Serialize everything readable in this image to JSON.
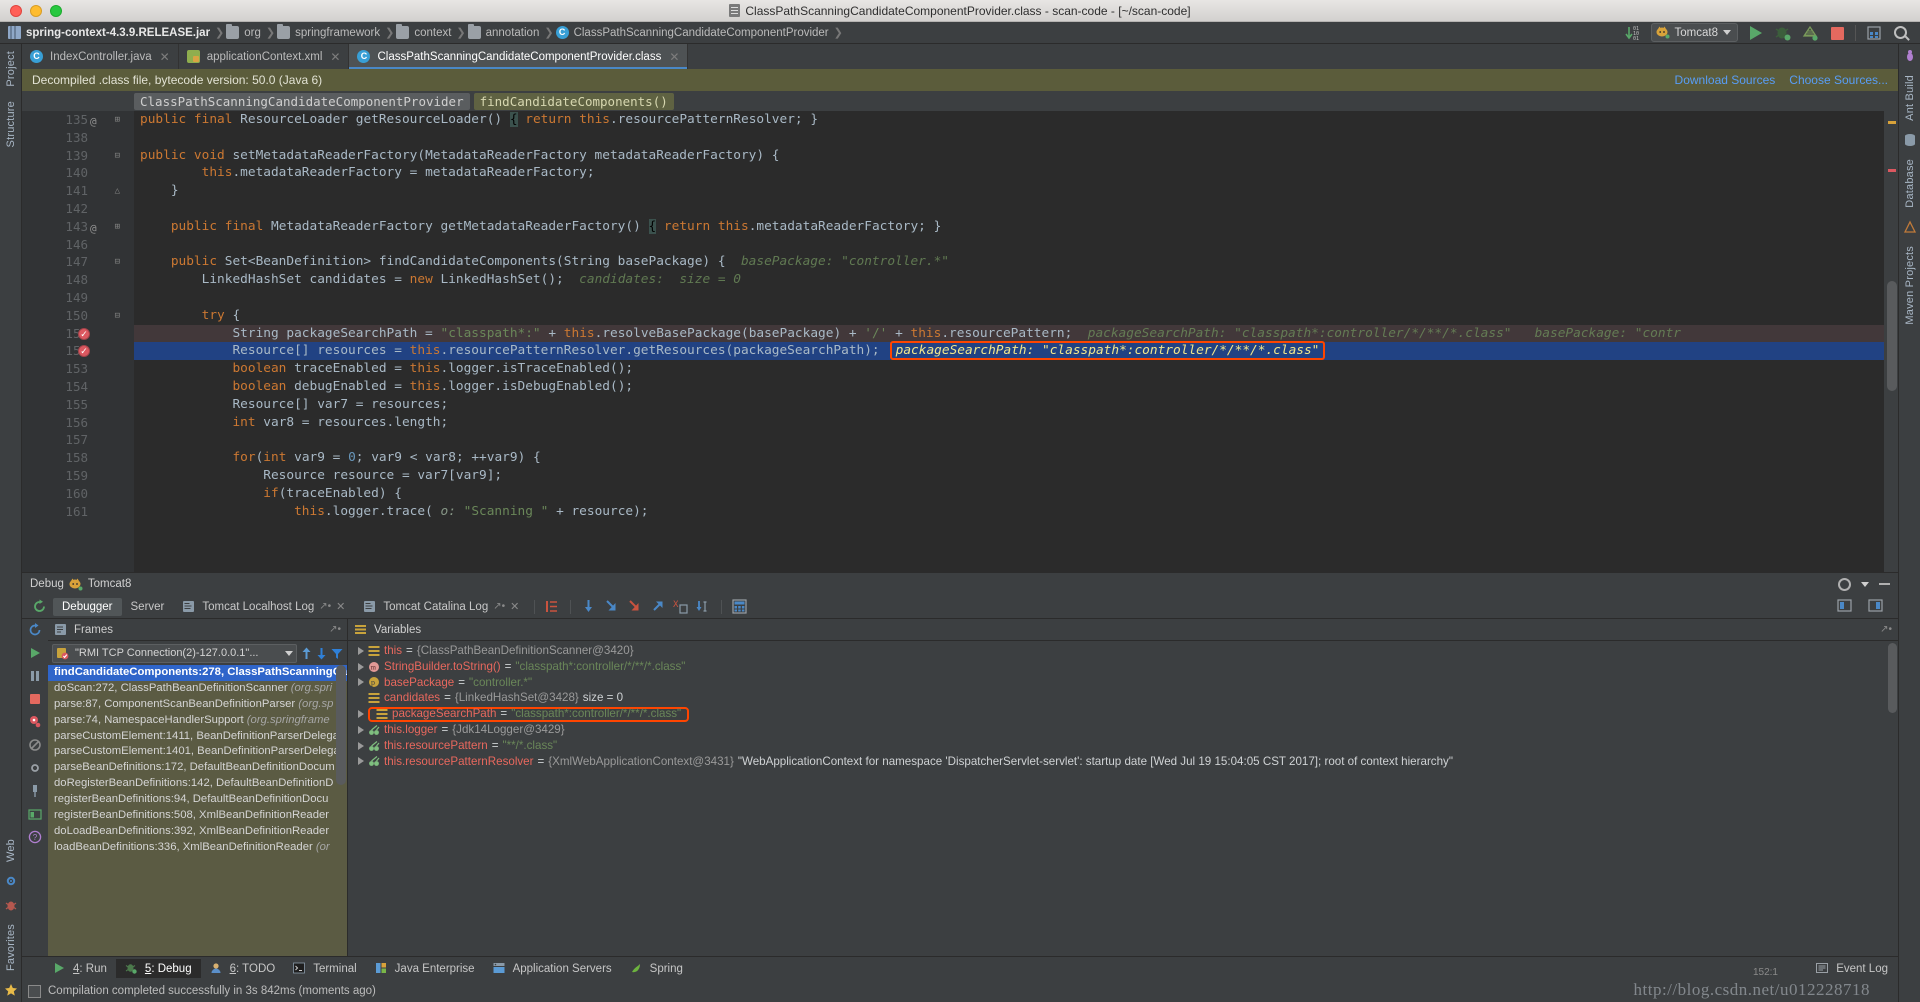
{
  "window": {
    "title": "ClassPathScanningCandidateComponentProvider.class - scan-code - [~/scan-code]",
    "title_icon": "document-icon"
  },
  "breadcrumb": {
    "items": [
      {
        "label": "spring-context-4.3.9.RELEASE.jar",
        "icon": "jar-icon",
        "bold": true
      },
      {
        "label": "org",
        "icon": "folder-icon",
        "bold": false
      },
      {
        "label": "springframework",
        "icon": "folder-icon",
        "bold": false
      },
      {
        "label": "context",
        "icon": "folder-icon",
        "bold": false
      },
      {
        "label": "annotation",
        "icon": "folder-icon",
        "bold": false
      },
      {
        "label": "ClassPathScanningCandidateComponentProvider",
        "icon": "class-icon",
        "bold": false
      }
    ],
    "separator": "›"
  },
  "toolbar": {
    "run_config": "Tomcat8",
    "buttons": [
      {
        "name": "update-running-app-icon",
        "label": ""
      },
      {
        "name": "run-button",
        "label": ""
      },
      {
        "name": "debug-button",
        "label": ""
      },
      {
        "name": "coverage-button",
        "label": ""
      },
      {
        "name": "stop-button",
        "label": ""
      },
      {
        "name": "layout-button",
        "label": ""
      },
      {
        "name": "search-everywhere-button",
        "label": ""
      }
    ]
  },
  "left_strip": {
    "tabs": [
      "Project",
      "Structure",
      "Favorites"
    ],
    "bottom_tabs": [
      "Web"
    ]
  },
  "right_strip": {
    "tabs": [
      "Ant Build",
      "Database",
      "Maven Projects"
    ]
  },
  "editor_tabs": [
    {
      "label": "IndexController.java",
      "icon": "java-class-icon",
      "active": false,
      "closable": true
    },
    {
      "label": "applicationContext.xml",
      "icon": "xml-file-icon",
      "active": false,
      "closable": true
    },
    {
      "label": "ClassPathScanningCandidateComponentProvider.class",
      "icon": "decompiled-class-icon",
      "active": true,
      "closable": true
    }
  ],
  "notice": {
    "text": "Decompiled .class file, bytecode version: 50.0 (Java 6)",
    "links": [
      "Download Sources",
      "Choose Sources..."
    ]
  },
  "chips": [
    {
      "label": "ClassPathScanningCandidateComponentProvider",
      "current": false
    },
    {
      "label": "findCandidateComponents()",
      "current": true
    }
  ],
  "editor": {
    "first_visible_line": 135,
    "lines": [
      {
        "num": "135",
        "partial": true,
        "breakpoint": false,
        "at": true,
        "fold": "+",
        "highlight": "none",
        "tokens": [
          {
            "t": "kw",
            "v": "public final "
          },
          {
            "t": "txt",
            "v": "ResourceLoader getResourceLoader() "
          },
          {
            "t": "brace",
            "v": "{"
          },
          {
            "t": "kw",
            "v": " return "
          },
          {
            "t": "kw2",
            "v": "this"
          },
          {
            "t": "txt",
            "v": ".resourcePatternResolver; }"
          }
        ]
      },
      {
        "num": "138",
        "breakpoint": false,
        "fold": "",
        "highlight": "none",
        "tokens": []
      },
      {
        "num": "139",
        "breakpoint": false,
        "fold": "-",
        "highlight": "none",
        "tokens": [
          {
            "t": "kw",
            "v": "public void "
          },
          {
            "t": "txt",
            "v": "setMetadataReaderFactory(MetadataReaderFactory metadataReaderFactory) {"
          }
        ]
      },
      {
        "num": "140",
        "breakpoint": false,
        "fold": "",
        "highlight": "none",
        "tokens": [
          {
            "t": "kw2",
            "v": "        this"
          },
          {
            "t": "txt",
            "v": ".metadataReaderFactory = metadataReaderFactory;"
          }
        ]
      },
      {
        "num": "141",
        "breakpoint": false,
        "fold": "^",
        "highlight": "none",
        "tokens": [
          {
            "t": "txt",
            "v": "    }"
          }
        ]
      },
      {
        "num": "142",
        "breakpoint": false,
        "fold": "",
        "highlight": "none",
        "tokens": []
      },
      {
        "num": "143",
        "breakpoint": false,
        "at": true,
        "fold": "+",
        "highlight": "none",
        "tokens": [
          {
            "t": "kw",
            "v": "    public final "
          },
          {
            "t": "txt",
            "v": "MetadataReaderFactory getMetadataReaderFactory() "
          },
          {
            "t": "brace",
            "v": "{"
          },
          {
            "t": "kw",
            "v": " return "
          },
          {
            "t": "kw2",
            "v": "this"
          },
          {
            "t": "txt",
            "v": ".metadataReaderFactory; }"
          }
        ]
      },
      {
        "num": "146",
        "breakpoint": false,
        "fold": "",
        "highlight": "none",
        "tokens": []
      },
      {
        "num": "147",
        "breakpoint": false,
        "fold": "-",
        "highlight": "none",
        "tokens": [
          {
            "t": "kw",
            "v": "    public "
          },
          {
            "t": "txt",
            "v": "Set<BeanDefinition> findCandidateComponents(String basePackage) {"
          },
          {
            "t": "hint",
            "v": "  basePackage: \"controller.*\""
          }
        ]
      },
      {
        "num": "148",
        "breakpoint": false,
        "fold": "",
        "highlight": "none",
        "tokens": [
          {
            "t": "txt",
            "v": "        LinkedHashSet candidates = "
          },
          {
            "t": "kw",
            "v": "new "
          },
          {
            "t": "txt",
            "v": "LinkedHashSet();"
          },
          {
            "t": "hint",
            "v": "  candidates:  size = 0"
          }
        ]
      },
      {
        "num": "149",
        "breakpoint": false,
        "fold": "",
        "highlight": "none",
        "tokens": []
      },
      {
        "num": "150",
        "breakpoint": false,
        "fold": "-",
        "highlight": "none",
        "tokens": [
          {
            "t": "kw",
            "v": "        try "
          },
          {
            "t": "txt",
            "v": "{"
          }
        ]
      },
      {
        "num": "151",
        "breakpoint": true,
        "fold": "",
        "highlight": "dark",
        "tokens": [
          {
            "t": "txt",
            "v": "            String packageSearchPath = "
          },
          {
            "t": "str",
            "v": "\"classpath*:\""
          },
          {
            "t": "txt",
            "v": " + "
          },
          {
            "t": "kw2",
            "v": "this"
          },
          {
            "t": "txt",
            "v": ".resolveBasePackage(basePackage) + "
          },
          {
            "t": "str",
            "v": "'/'"
          },
          {
            "t": "txt",
            "v": " + "
          },
          {
            "t": "kw2",
            "v": "this"
          },
          {
            "t": "txt",
            "v": ".resourcePattern;"
          },
          {
            "t": "hint",
            "v": "  packageSearchPath: \"classpath*:controller/*/**/*.class\"   basePackage: \"contr"
          }
        ]
      },
      {
        "num": "152",
        "breakpoint": true,
        "fold": "",
        "highlight": "blue",
        "tokens": [
          {
            "t": "txt",
            "v": "            Resource[] resources = "
          },
          {
            "t": "kw2",
            "v": "this"
          },
          {
            "t": "txt",
            "v": ".resourcePatternResolver.getResources(packageSearchPath);"
          },
          {
            "t": "boxed",
            "v": "packageSearchPath: \"classpath*:controller/*/**/*.class\""
          }
        ]
      },
      {
        "num": "153",
        "breakpoint": false,
        "fold": "",
        "highlight": "none",
        "tokens": [
          {
            "t": "kw",
            "v": "            boolean "
          },
          {
            "t": "txt",
            "v": "traceEnabled = "
          },
          {
            "t": "kw2",
            "v": "this"
          },
          {
            "t": "txt",
            "v": ".logger.isTraceEnabled();"
          }
        ]
      },
      {
        "num": "154",
        "breakpoint": false,
        "fold": "",
        "highlight": "none",
        "tokens": [
          {
            "t": "kw",
            "v": "            boolean "
          },
          {
            "t": "txt",
            "v": "debugEnabled = "
          },
          {
            "t": "kw2",
            "v": "this"
          },
          {
            "t": "txt",
            "v": ".logger.isDebugEnabled();"
          }
        ]
      },
      {
        "num": "155",
        "breakpoint": false,
        "fold": "",
        "highlight": "none",
        "tokens": [
          {
            "t": "txt",
            "v": "            Resource[] var7 = resources;"
          }
        ]
      },
      {
        "num": "156",
        "breakpoint": false,
        "fold": "",
        "highlight": "none",
        "tokens": [
          {
            "t": "kw",
            "v": "            int "
          },
          {
            "t": "txt",
            "v": "var8 = resources.length;"
          }
        ]
      },
      {
        "num": "157",
        "breakpoint": false,
        "fold": "",
        "highlight": "none",
        "tokens": []
      },
      {
        "num": "158",
        "breakpoint": false,
        "fold": "",
        "highlight": "none",
        "tokens": [
          {
            "t": "kw",
            "v": "            for"
          },
          {
            "t": "txt",
            "v": "("
          },
          {
            "t": "kw",
            "v": "int "
          },
          {
            "t": "txt",
            "v": "var9 = "
          },
          {
            "t": "num",
            "v": "0"
          },
          {
            "t": "txt",
            "v": "; var9 < var8; ++var9) {"
          }
        ]
      },
      {
        "num": "159",
        "breakpoint": false,
        "fold": "",
        "highlight": "none",
        "tokens": [
          {
            "t": "txt",
            "v": "                Resource resource = var7[var9];"
          }
        ]
      },
      {
        "num": "160",
        "breakpoint": false,
        "fold": "",
        "highlight": "none",
        "tokens": [
          {
            "t": "kw",
            "v": "                if"
          },
          {
            "t": "txt",
            "v": "(traceEnabled) {"
          }
        ]
      },
      {
        "num": "161",
        "breakpoint": false,
        "fold": "",
        "highlight": "none",
        "partial_bottom": true,
        "tokens": [
          {
            "t": "kw2",
            "v": "                    this"
          },
          {
            "t": "txt",
            "v": ".logger.trace("
          },
          {
            "t": "hint2",
            "v": " o: "
          },
          {
            "t": "str",
            "v": "\"Scanning \""
          },
          {
            "t": "txt",
            "v": " + resource);"
          }
        ]
      }
    ]
  },
  "debug": {
    "window_title": "Debug",
    "config_name": "Tomcat8",
    "tabs": [
      {
        "label": "Debugger",
        "active": true,
        "pinnable": false,
        "closable": false,
        "icon": ""
      },
      {
        "label": "Server",
        "active": false,
        "pinnable": false,
        "closable": false,
        "icon": ""
      },
      {
        "label": "Tomcat Localhost Log",
        "active": false,
        "pinnable": true,
        "closable": true,
        "icon": "log-icon"
      },
      {
        "label": "Tomcat Catalina Log",
        "active": false,
        "pinnable": true,
        "closable": true,
        "icon": "log-icon"
      }
    ],
    "step_buttons": [
      "show-execution-point-icon",
      "step-over-icon",
      "step-into-icon",
      "force-step-into-icon",
      "step-out-icon",
      "drop-frame-icon",
      "run-to-cursor-icon",
      "evaluate-expression-icon"
    ],
    "frames": {
      "title": "Frames",
      "thread": "\"RMI TCP Connection(2)-127.0.0.1\"...",
      "items": [
        {
          "method": "findCandidateComponents:278,",
          "cls": " ClassPathScanningCan",
          "pkg": "",
          "selected": true
        },
        {
          "method": "doScan:272,",
          "cls": " ClassPathBeanDefinitionScanner",
          "pkg": " (org.spri",
          "selected": false
        },
        {
          "method": "parse:87,",
          "cls": " ComponentScanBeanDefinitionParser",
          "pkg": " (org.sp",
          "selected": false
        },
        {
          "method": "parse:74,",
          "cls": " NamespaceHandlerSupport",
          "pkg": " (org.springframe",
          "selected": false
        },
        {
          "method": "parseCustomElement:1411,",
          "cls": " BeanDefinitionParserDelega",
          "pkg": "",
          "selected": false
        },
        {
          "method": "parseCustomElement:1401,",
          "cls": " BeanDefinitionParserDelega",
          "pkg": "",
          "selected": false
        },
        {
          "method": "parseBeanDefinitions:172,",
          "cls": " DefaultBeanDefinitionDocum",
          "pkg": "",
          "selected": false
        },
        {
          "method": "doRegisterBeanDefinitions:142,",
          "cls": " DefaultBeanDefinitionD",
          "pkg": "",
          "selected": false
        },
        {
          "method": "registerBeanDefinitions:94,",
          "cls": " DefaultBeanDefinitionDocu",
          "pkg": "",
          "selected": false
        },
        {
          "method": "registerBeanDefinitions:508,",
          "cls": " XmlBeanDefinitionReader",
          "pkg": "",
          "selected": false
        },
        {
          "method": "doLoadBeanDefinitions:392,",
          "cls": " XmlBeanDefinitionReader",
          "pkg": "",
          "selected": false
        },
        {
          "method": "loadBeanDefinitions:336,",
          "cls": " XmlBeanDefinitionReader",
          "pkg": " (or",
          "selected": false
        }
      ]
    },
    "variables": {
      "title": "Variables",
      "rows": [
        {
          "expandable": true,
          "icon": "object-icon",
          "name": "this",
          "eq": " = ",
          "ref": "{ClassPathBeanDefinitionScanner@3420}",
          "value": "",
          "extra": "",
          "boxed": false
        },
        {
          "expandable": true,
          "icon": "method-icon",
          "name": "StringBuilder.toString()",
          "eq": " = ",
          "ref": "",
          "value": "\"classpath*:controller/*/**/*.class\"",
          "extra": "",
          "boxed": false
        },
        {
          "expandable": true,
          "icon": "param-icon",
          "name": "basePackage",
          "eq": " = ",
          "ref": "",
          "value": "\"controller.*\"",
          "extra": "",
          "boxed": false
        },
        {
          "expandable": false,
          "icon": "object-icon",
          "name": "candidates",
          "eq": " = ",
          "ref": "{LinkedHashSet@3428}",
          "value": "",
          "extra": "size = 0",
          "boxed": false
        },
        {
          "expandable": true,
          "icon": "object-icon",
          "name": "packageSearchPath",
          "eq": " = ",
          "ref": "",
          "value": "\"classpath*:controller/*/**/*.class\"",
          "extra": "",
          "boxed": true
        },
        {
          "expandable": true,
          "icon": "field-icon",
          "name": "this.logger",
          "eq": " = ",
          "ref": "{Jdk14Logger@3429}",
          "value": "",
          "extra": "",
          "boxed": false
        },
        {
          "expandable": true,
          "icon": "field-icon",
          "name": "this.resourcePattern",
          "eq": " = ",
          "ref": "",
          "value": "\"**/*.class\"",
          "extra": "",
          "boxed": false
        },
        {
          "expandable": true,
          "icon": "field-icon",
          "name": "this.resourcePatternResolver",
          "eq": " = ",
          "ref": "{XmlWebApplicationContext@3431}",
          "value": "\"WebApplicationContext for namespace 'DispatcherServlet-servlet': startup date [Wed Jul 19 15:04:05 CST 2017]; root of context hierarchy\"",
          "extra": "",
          "boxed": false
        }
      ]
    }
  },
  "bottom_tools": [
    {
      "num": "4",
      "label": ": Run",
      "icon": "run-icon",
      "active": false
    },
    {
      "num": "5",
      "label": ": Debug",
      "icon": "debug-icon",
      "active": true
    },
    {
      "num": "6",
      "label": ": TODO",
      "icon": "todo-icon",
      "active": false
    },
    {
      "num": "",
      "label": "Terminal",
      "icon": "terminal-icon",
      "active": false
    },
    {
      "num": "",
      "label": "Java Enterprise",
      "icon": "java-ee-icon",
      "active": false
    },
    {
      "num": "",
      "label": "Application Servers",
      "icon": "app-servers-icon",
      "active": false
    },
    {
      "num": "",
      "label": "Spring",
      "icon": "spring-icon",
      "active": false
    }
  ],
  "event_log": "Event Log",
  "status": {
    "message": "Compilation completed successfully in 3s 842ms (moments ago)",
    "caret": "152:1"
  },
  "watermark": "http://blog.csdn.net/u012228718",
  "colors": {
    "accent_blue": "#2f65ca",
    "highlight_orange": "#ff4500",
    "editor_bg": "#2b2b2b",
    "panel_bg": "#3c3f41",
    "notice_bg": "#5b5c3b",
    "frames_bg": "#5b5b43",
    "string_green": "#6a8759",
    "keyword_orange": "#cc7832"
  }
}
